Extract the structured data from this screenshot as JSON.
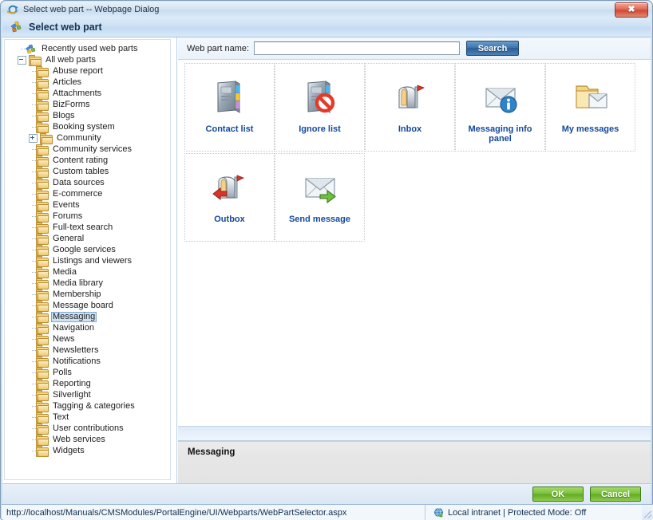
{
  "window": {
    "titlebar_text": "Select web part -- Webpage Dialog",
    "close_label": "✕",
    "header_title": "Select web part"
  },
  "sidebar": {
    "items": [
      {
        "label": "Recently used web parts",
        "level": 0,
        "icon": "puzzle-icon",
        "expander": "none",
        "selected": false
      },
      {
        "label": "All web parts",
        "level": 1,
        "icon": "folder-icon",
        "expander": "minus",
        "selected": false
      },
      {
        "label": "Abuse report",
        "level": 2,
        "icon": "folder-icon",
        "expander": "none",
        "selected": false
      },
      {
        "label": "Articles",
        "level": 2,
        "icon": "folder-icon",
        "expander": "none",
        "selected": false
      },
      {
        "label": "Attachments",
        "level": 2,
        "icon": "folder-icon",
        "expander": "none",
        "selected": false
      },
      {
        "label": "BizForms",
        "level": 2,
        "icon": "folder-icon",
        "expander": "none",
        "selected": false
      },
      {
        "label": "Blogs",
        "level": 2,
        "icon": "folder-icon",
        "expander": "none",
        "selected": false
      },
      {
        "label": "Booking system",
        "level": 2,
        "icon": "folder-icon",
        "expander": "none",
        "selected": false
      },
      {
        "label": "Community",
        "level": 2,
        "icon": "folder-icon",
        "expander": "plus",
        "selected": false
      },
      {
        "label": "Community services",
        "level": 2,
        "icon": "folder-icon",
        "expander": "none",
        "selected": false
      },
      {
        "label": "Content rating",
        "level": 2,
        "icon": "folder-icon",
        "expander": "none",
        "selected": false
      },
      {
        "label": "Custom tables",
        "level": 2,
        "icon": "folder-icon",
        "expander": "none",
        "selected": false
      },
      {
        "label": "Data sources",
        "level": 2,
        "icon": "folder-icon",
        "expander": "none",
        "selected": false
      },
      {
        "label": "E-commerce",
        "level": 2,
        "icon": "folder-icon",
        "expander": "none",
        "selected": false
      },
      {
        "label": "Events",
        "level": 2,
        "icon": "folder-icon",
        "expander": "none",
        "selected": false
      },
      {
        "label": "Forums",
        "level": 2,
        "icon": "folder-icon",
        "expander": "none",
        "selected": false
      },
      {
        "label": "Full-text search",
        "level": 2,
        "icon": "folder-icon",
        "expander": "none",
        "selected": false
      },
      {
        "label": "General",
        "level": 2,
        "icon": "folder-icon",
        "expander": "none",
        "selected": false
      },
      {
        "label": "Google services",
        "level": 2,
        "icon": "folder-icon",
        "expander": "none",
        "selected": false
      },
      {
        "label": "Listings and viewers",
        "level": 2,
        "icon": "folder-icon",
        "expander": "none",
        "selected": false
      },
      {
        "label": "Media",
        "level": 2,
        "icon": "folder-icon",
        "expander": "none",
        "selected": false
      },
      {
        "label": "Media library",
        "level": 2,
        "icon": "folder-icon",
        "expander": "none",
        "selected": false
      },
      {
        "label": "Membership",
        "level": 2,
        "icon": "folder-icon",
        "expander": "none",
        "selected": false
      },
      {
        "label": "Message board",
        "level": 2,
        "icon": "folder-icon",
        "expander": "none",
        "selected": false
      },
      {
        "label": "Messaging",
        "level": 2,
        "icon": "folder-icon",
        "expander": "none",
        "selected": true
      },
      {
        "label": "Navigation",
        "level": 2,
        "icon": "folder-icon",
        "expander": "none",
        "selected": false
      },
      {
        "label": "News",
        "level": 2,
        "icon": "folder-icon",
        "expander": "none",
        "selected": false
      },
      {
        "label": "Newsletters",
        "level": 2,
        "icon": "folder-icon",
        "expander": "none",
        "selected": false
      },
      {
        "label": "Notifications",
        "level": 2,
        "icon": "folder-icon",
        "expander": "none",
        "selected": false
      },
      {
        "label": "Polls",
        "level": 2,
        "icon": "folder-icon",
        "expander": "none",
        "selected": false
      },
      {
        "label": "Reporting",
        "level": 2,
        "icon": "folder-icon",
        "expander": "none",
        "selected": false
      },
      {
        "label": "Silverlight",
        "level": 2,
        "icon": "folder-icon",
        "expander": "none",
        "selected": false
      },
      {
        "label": "Tagging & categories",
        "level": 2,
        "icon": "folder-icon",
        "expander": "none",
        "selected": false
      },
      {
        "label": "Text",
        "level": 2,
        "icon": "folder-icon",
        "expander": "none",
        "selected": false
      },
      {
        "label": "User contributions",
        "level": 2,
        "icon": "folder-icon",
        "expander": "none",
        "selected": false
      },
      {
        "label": "Web services",
        "level": 2,
        "icon": "folder-icon",
        "expander": "none",
        "selected": false
      },
      {
        "label": "Widgets",
        "level": 2,
        "icon": "folder-icon",
        "expander": "none",
        "selected": false
      }
    ]
  },
  "search": {
    "label": "Web part name:",
    "value": "",
    "placeholder": "",
    "button_label": "Search"
  },
  "webparts": [
    {
      "label": "Contact list",
      "icon": "address-book-icon"
    },
    {
      "label": "Ignore list",
      "icon": "address-book-blocked-icon"
    },
    {
      "label": "Inbox",
      "icon": "mailbox-inbox-icon"
    },
    {
      "label": "Messaging info panel",
      "icon": "envelope-info-icon"
    },
    {
      "label": "My messages",
      "icon": "folder-envelope-icon"
    },
    {
      "label": "Outbox",
      "icon": "mailbox-outbox-icon"
    },
    {
      "label": "Send message",
      "icon": "envelope-send-icon"
    }
  ],
  "description": {
    "title": "Messaging"
  },
  "footer": {
    "ok_label": "OK",
    "cancel_label": "Cancel"
  },
  "statusbar": {
    "url": "http://localhost/Manuals/CMSModules/PortalEngine/UI/Webparts/WebPartSelector.aspx",
    "zone": "Local intranet | Protected Mode: Off",
    "zone_icon": "globe-icon"
  },
  "colors": {
    "accent_blue": "#14489c",
    "button_green": "#62ab23",
    "search_blue": "#2e5e93",
    "selection": "#cfe2f3"
  }
}
